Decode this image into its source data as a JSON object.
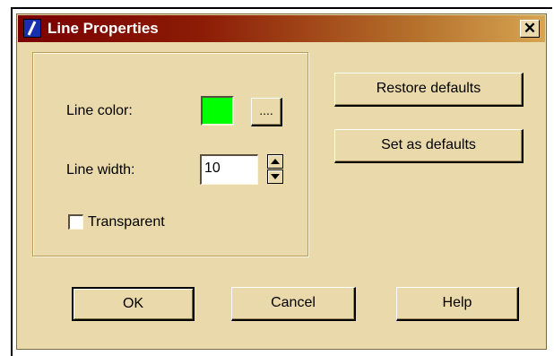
{
  "dialog": {
    "title": "Line Properties",
    "close_glyph": "✕",
    "title_icon": "pen-icon"
  },
  "form": {
    "line_color_label": "Line color:",
    "line_color_value": "#00ff00",
    "browse_label": "....",
    "line_width_label": "Line width:",
    "line_width_value": "10",
    "transparent_label": "Transparent",
    "transparent_checked": false
  },
  "side_buttons": {
    "restore_defaults": "Restore defaults",
    "set_as_defaults": "Set as defaults"
  },
  "footer": {
    "ok": "OK",
    "cancel": "Cancel",
    "help": "Help"
  }
}
